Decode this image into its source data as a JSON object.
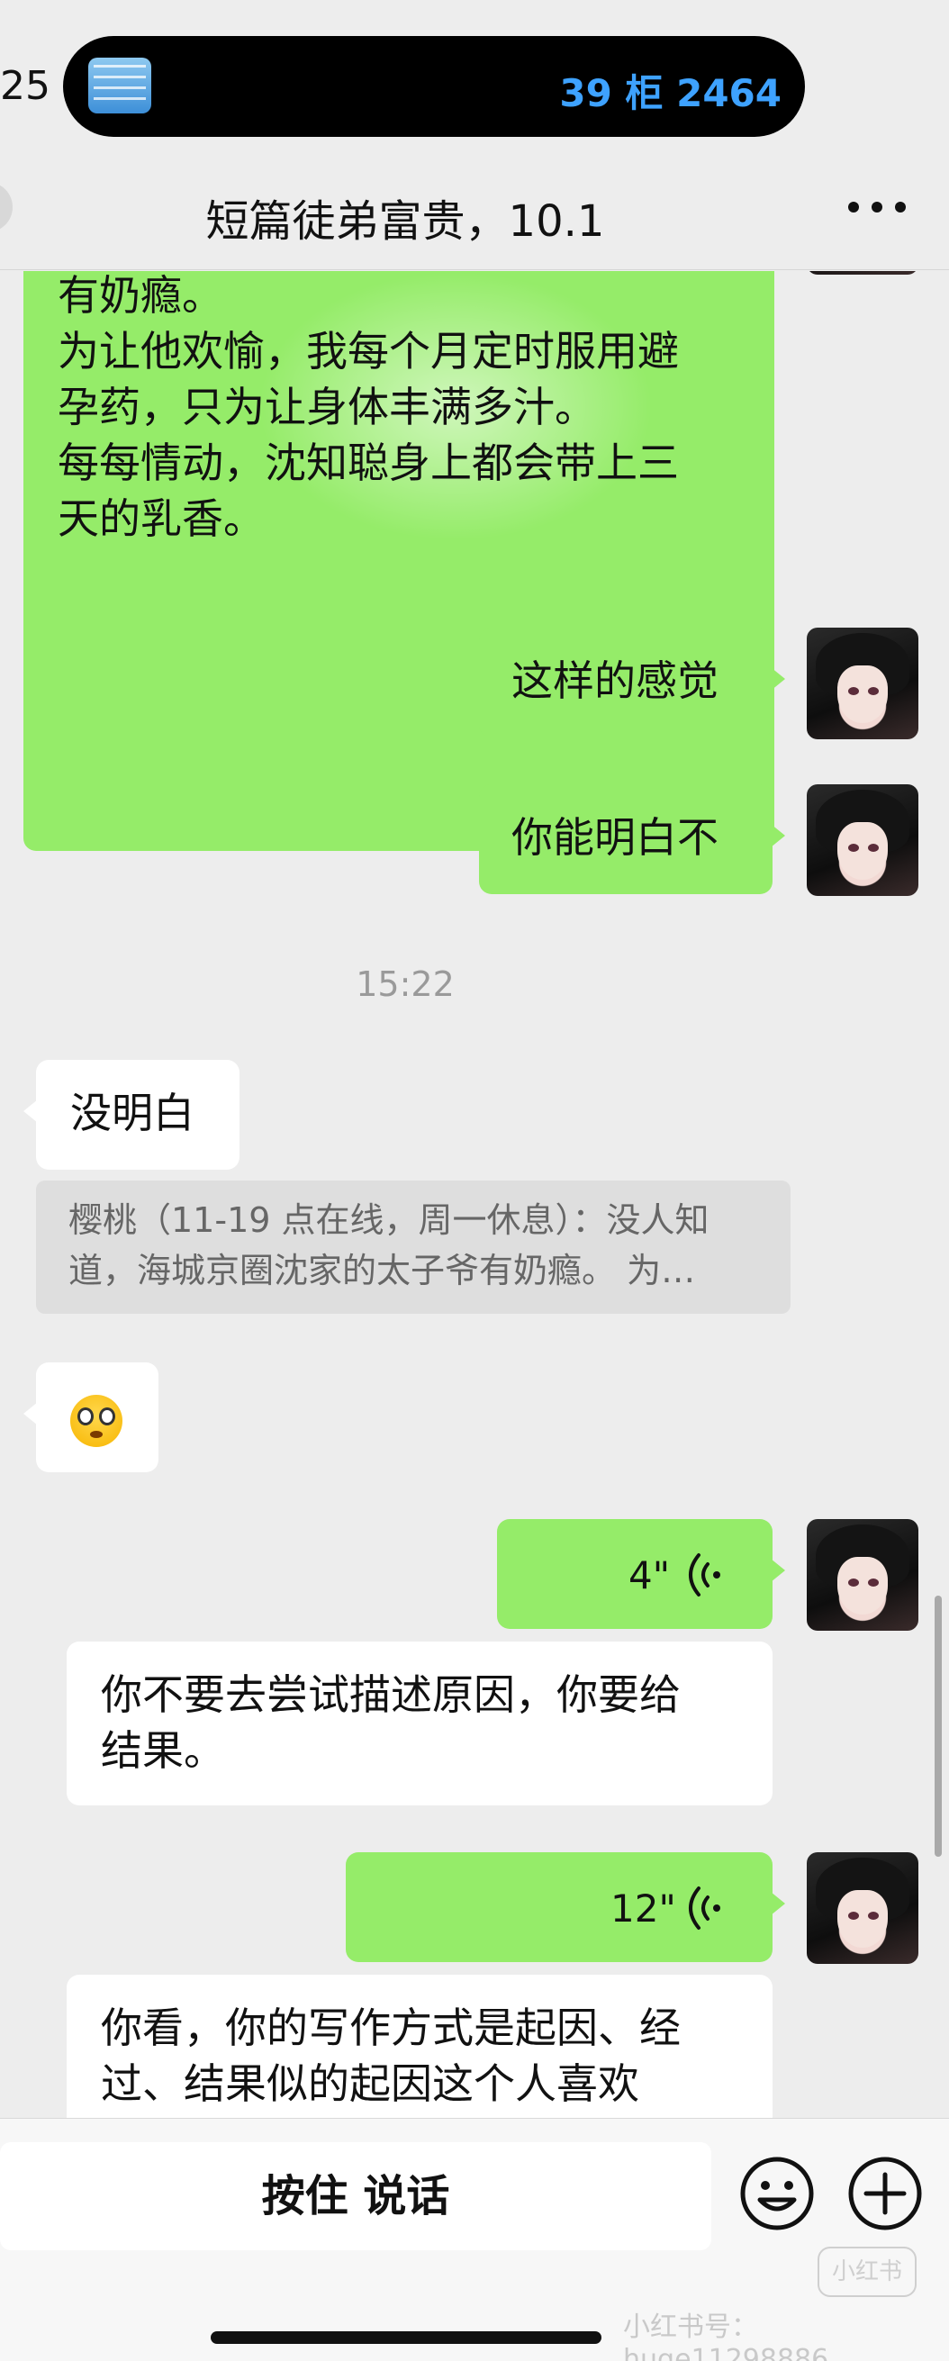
{
  "status_bar": {
    "time_partial": "25",
    "live_activity": {
      "text": "39 柜 2464",
      "icon": "package-icon"
    }
  },
  "nav": {
    "title": "短篇徒弟富贵，10.1",
    "more_icon": "more-dots-icon"
  },
  "messages": {
    "long_sent": {
      "lines": [
        "有奶瘾。",
        "为让他欢愉，我每个月定时服用避",
        "孕药，只为让身体丰满多汁。",
        "每每情动，沈知聪身上都会带上三",
        "天的乳香。"
      ]
    },
    "sent_1": "这样的感觉",
    "sent_2": "你能明白不",
    "timestamp": "15:22",
    "received_1": "没明白",
    "quote": {
      "line1": "樱桃（11-19 点在线，周一休息）：没人知",
      "line2": "道，海城京圈沈家的太子爷有奶瘾。 为…"
    },
    "received_emoji": "😳",
    "voice_1": {
      "duration": "4\"",
      "transcript": [
        "你不要去尝试描述原因，你要给",
        "结果。"
      ]
    },
    "voice_2": {
      "duration": "12\"",
      "transcript": [
        "你看，你的写作方式是起因、经",
        "过、结果似的起因这个人喜欢"
      ]
    }
  },
  "input_bar": {
    "hold_to_talk": "按住 说话",
    "emoji_icon": "emoji-icon",
    "plus_icon": "plus-icon"
  },
  "watermark": {
    "badge": "小红书",
    "id": "小红书号：huge11298886"
  },
  "colors": {
    "sent_bubble": "#95ec69",
    "received_bubble": "#ffffff",
    "background": "#ededed",
    "island_text": "#3ea2ff"
  }
}
